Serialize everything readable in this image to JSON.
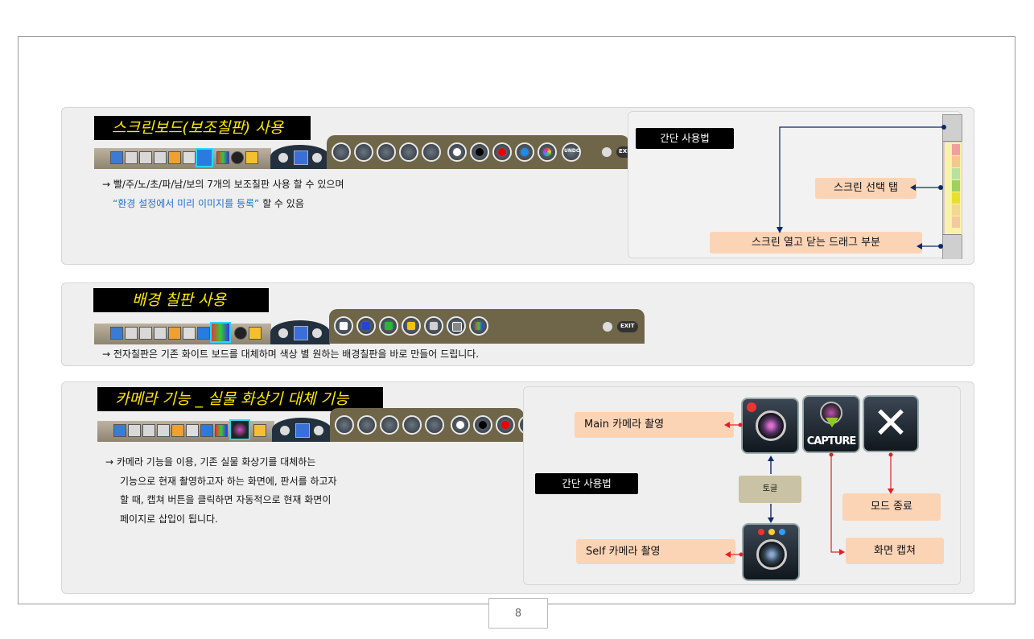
{
  "section1": {
    "title": "스크린보드(보조칠판) 사용",
    "line1": "→ 빨/주/노/초/파/남/보의  7개의 보조칠판 사용 할 수 있으며",
    "line2_quote": "“환경 설정에서 미리 이미지를 등록”",
    "line2_rest": " 할 수 있음",
    "undo_label": "UNDO",
    "exit_label": "EXIT",
    "guide": {
      "badge": "간단 사용법",
      "screen_tab": "스크린 선택 탭",
      "drag_area": "스크린 열고 닫는 드래그 부분"
    }
  },
  "section2": {
    "title": "배경 칠판 사용",
    "line1": "→ 전자칠판은 기존 화이트 보드를 대체하며 색상 별 원하는 배경칠판을 바로 만들어 드립니다.",
    "exit_label": "EXIT"
  },
  "section3": {
    "title": "카메라 기능 _ 실물 화상기 대체 기능",
    "lines": [
      "→ 카메라 기능을 이용, 기존 실물 화상기를 대체하는",
      "기능으로 현재 촬영하고자 하는 화면에, 판서를 하고자",
      "할 때, 캡쳐 버튼을 클릭하면 자동적으로 현재 화면이",
      "페이지로 삽입이 됩니다."
    ],
    "guide": {
      "badge": "간단 사용법",
      "main_camera": "Main 카메라 촬영",
      "self_camera": "Self 카메라 촬영",
      "toggle": "토글",
      "mode_exit": "모드 종료",
      "capture": "화면 캡쳐",
      "capture_icon_label": "CAPTURE"
    }
  },
  "page_number": "8",
  "colors": {
    "title_text": "#ffe800",
    "accent_blue": "#1f6fd1",
    "label_peach": "#fbd4b6",
    "arrow_navy": "#0b2a6b",
    "arrow_red": "#e02020"
  },
  "icons": {
    "pen_set": [
      "pen-white-icon",
      "pen-white-icon",
      "pen-white-icon",
      "pen-white-icon",
      "pen-white-icon"
    ],
    "ink_set": [
      "ink-white-icon",
      "ink-black-icon",
      "ink-red-icon",
      "ink-blue-icon",
      "ink-rainbow-icon"
    ],
    "board_set": [
      "board-white-icon",
      "board-blue-icon",
      "board-green-icon",
      "board-yellow-icon",
      "board-gray-icon",
      "board-image-icon",
      "board-color-icon"
    ]
  }
}
